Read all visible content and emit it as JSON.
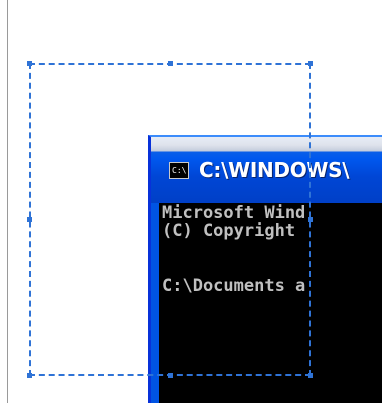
{
  "cmd_window": {
    "title": "C:\\WINDOWS\\",
    "icon_label": "C:\\",
    "lines": [
      "Microsoft Wind",
      "(C) Copyright ",
      "C:\\Documents a"
    ]
  },
  "colors": {
    "selection": "#2f73d6",
    "titlebar": "#0054e3",
    "console_bg": "#000000",
    "console_text": "#c0c0c0"
  }
}
